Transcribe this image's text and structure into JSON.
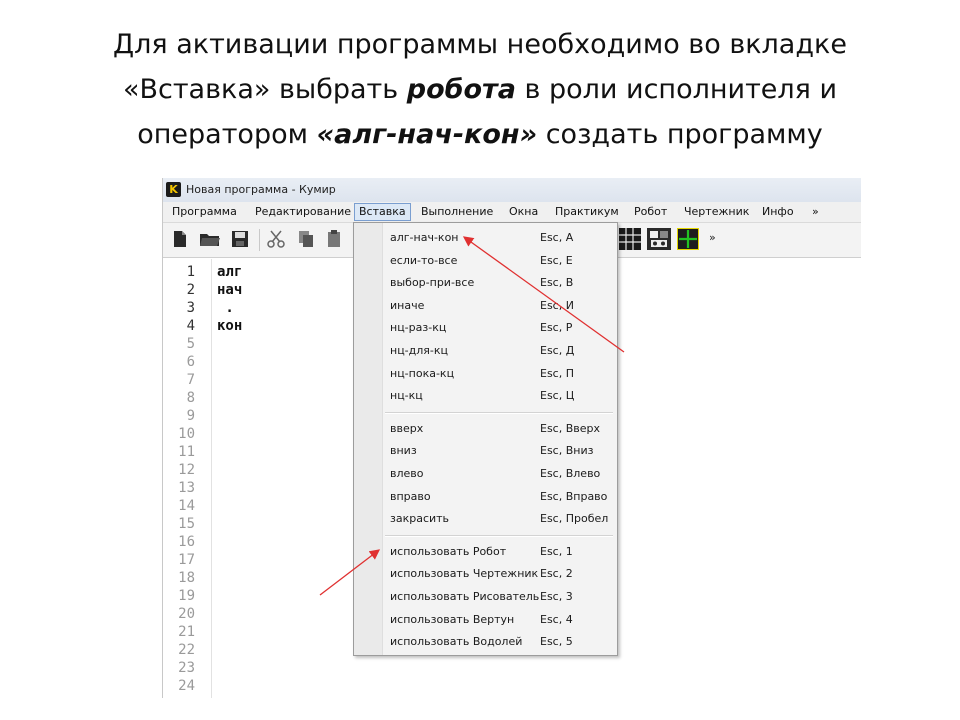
{
  "slide": {
    "title_line1": "Для активации программы необходимо во вкладке",
    "title_line2_a": "«Вставка» выбрать ",
    "title_line2_b": "робота",
    "title_line2_c": " в роли исполнителя и",
    "title_line3_a": "оператором ",
    "title_line3_b": "«алг-нач-кон»",
    "title_line3_c": " создать программу"
  },
  "window": {
    "icon_letter": "K",
    "title": "Новая программа - Кумир"
  },
  "menubar": [
    {
      "label": "Программа"
    },
    {
      "label": "Редактирование"
    },
    {
      "label": "Вставка"
    },
    {
      "label": "Выполнение"
    },
    {
      "label": "Окна"
    },
    {
      "label": "Практикум"
    },
    {
      "label": "Робот"
    },
    {
      "label": "Чертежник"
    },
    {
      "label": "Инфо"
    },
    {
      "label": "»"
    }
  ],
  "toolbar": {
    "overflow_label": "»",
    "icons": [
      "new-file-icon",
      "open-folder-icon",
      "save-icon",
      "cut-icon",
      "copy-icon",
      "paste-icon",
      "grid-icon",
      "robot-game-icon",
      "drawer-icon"
    ]
  },
  "editor": {
    "line_numbers": [
      "1",
      "2",
      "3",
      "4",
      "5",
      "6",
      "7",
      "8",
      "9",
      "10",
      "11",
      "12",
      "13",
      "14",
      "15",
      "16",
      "17",
      "18",
      "19",
      "20",
      "21",
      "22",
      "23",
      "24"
    ],
    "code_lines": [
      "алг",
      "нач",
      " .",
      "кон"
    ]
  },
  "dropdown": {
    "group1": [
      {
        "label": "алг-нач-кон",
        "shortcut": "Esc, A"
      },
      {
        "label": "если-то-все",
        "shortcut": "Esc, E"
      },
      {
        "label": "выбор-при-все",
        "shortcut": "Esc, B"
      },
      {
        "label": "иначе",
        "shortcut": "Esc, И"
      },
      {
        "label": "нц-раз-кц",
        "shortcut": "Esc, Р"
      },
      {
        "label": "нц-для-кц",
        "shortcut": "Esc, Д"
      },
      {
        "label": "нц-пока-кц",
        "shortcut": "Esc, П"
      },
      {
        "label": "нц-кц",
        "shortcut": "Esc, Ц"
      }
    ],
    "group2": [
      {
        "label": "вверх",
        "shortcut": "Esc, Вверх"
      },
      {
        "label": "вниз",
        "shortcut": "Esc, Вниз"
      },
      {
        "label": "влево",
        "shortcut": "Esc, Влево"
      },
      {
        "label": "вправо",
        "shortcut": "Esc, Вправо"
      },
      {
        "label": "закрасить",
        "shortcut": "Esc, Пробел"
      }
    ],
    "group3": [
      {
        "label": "использовать Робот",
        "shortcut": "Esc, 1"
      },
      {
        "label": "использовать Чертежник",
        "shortcut": "Esc, 2"
      },
      {
        "label": "использовать Рисователь",
        "shortcut": "Esc, 3"
      },
      {
        "label": "использовать Вертун",
        "shortcut": "Esc, 4"
      },
      {
        "label": "использовать Водолей",
        "shortcut": "Esc, 5"
      }
    ]
  },
  "colors": {
    "annotation_arrow": "#e03030",
    "menu_active_border": "#7a9ed0"
  }
}
